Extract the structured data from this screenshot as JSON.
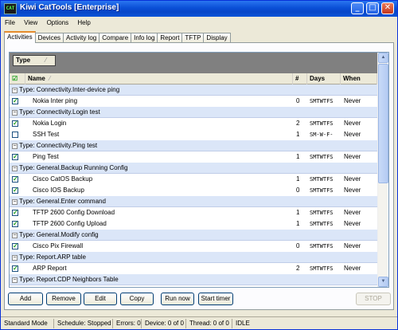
{
  "window": {
    "app_icon_text": "CAT",
    "title": "Kiwi CatTools [Enterprise]",
    "controls": {
      "minimize": "_",
      "maximize": "□",
      "close": "✕"
    }
  },
  "menu": [
    "File",
    "View",
    "Options",
    "Help"
  ],
  "tabs": [
    "Activities",
    "Devices",
    "Activity log",
    "Compare",
    "Info log",
    "Report",
    "TFTP",
    "Display"
  ],
  "grid": {
    "group_by": "Type",
    "columns": {
      "check": "☑",
      "name": "Name",
      "num": "#",
      "days": "Days",
      "when": "When"
    },
    "groups": [
      {
        "label": "Type: Connectivity.Inter-device ping",
        "items": [
          {
            "name": "Nokia Inter ping",
            "checked": true,
            "num": "0",
            "days": "SMTWTFS",
            "when": "Never"
          }
        ]
      },
      {
        "label": "Type: Connectivity.Login test",
        "items": [
          {
            "name": "Nokia Login",
            "checked": true,
            "num": "2",
            "days": "SMTWTFS",
            "when": "Never"
          },
          {
            "name": "SSH Test",
            "checked": false,
            "num": "1",
            "days": "SM-W-F-",
            "when": "Never"
          }
        ]
      },
      {
        "label": "Type: Connectivity.Ping test",
        "items": [
          {
            "name": "Ping Test",
            "checked": true,
            "num": "1",
            "days": "SMTWTFS",
            "when": "Never"
          }
        ]
      },
      {
        "label": "Type: General.Backup Running Config",
        "items": [
          {
            "name": "Cisco CatOS Backup",
            "checked": true,
            "num": "1",
            "days": "SMTWTFS",
            "when": "Never"
          },
          {
            "name": "Cisco IOS Backup",
            "checked": true,
            "num": "0",
            "days": "SMTWTFS",
            "when": "Never"
          }
        ]
      },
      {
        "label": "Type: General.Enter command",
        "items": [
          {
            "name": "TFTP 2600 Config Download",
            "checked": true,
            "num": "1",
            "days": "SMTWTFS",
            "when": "Never"
          },
          {
            "name": "TFTP 2600 Config Upload",
            "checked": true,
            "num": "1",
            "days": "SMTWTFS",
            "when": "Never"
          }
        ]
      },
      {
        "label": "Type: General.Modify config",
        "items": [
          {
            "name": "Cisco Pix Firewall",
            "checked": true,
            "num": "0",
            "days": "SMTWTFS",
            "when": "Never"
          }
        ]
      },
      {
        "label": "Type: Report.ARP table",
        "items": [
          {
            "name": "ARP Report",
            "checked": true,
            "num": "2",
            "days": "SMTWTFS",
            "when": "Never"
          }
        ]
      },
      {
        "label": "Type: Report.CDP Neighbors Table",
        "items": []
      }
    ]
  },
  "buttons": {
    "add": "Add",
    "remove": "Remove",
    "edit": "Edit",
    "copy": "Copy",
    "run_now": "Run now",
    "start_timer": "Start timer",
    "stop": "STOP"
  },
  "status": {
    "mode": "Standard Mode",
    "schedule": "Schedule: Stopped",
    "errors": "Errors: 0",
    "device": "Device: 0 of 0",
    "thread": "Thread: 0 of 0",
    "state": "IDLE"
  }
}
